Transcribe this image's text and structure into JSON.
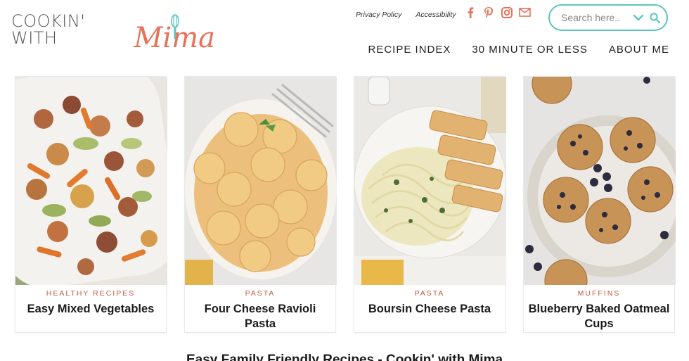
{
  "brand": {
    "logo_text": "COOKIN' WITH",
    "logo_script": "Mima",
    "accent_color": "#e8715a",
    "teal_color": "#5cc4c2"
  },
  "utility_nav": {
    "privacy": "Privacy Policy",
    "accessibility": "Accessibility"
  },
  "social_icons": [
    "facebook-icon",
    "pinterest-icon",
    "instagram-icon",
    "email-icon"
  ],
  "search": {
    "placeholder": "Search here.."
  },
  "main_nav": [
    {
      "label": "RECIPE INDEX"
    },
    {
      "label": "30 MINUTE OR LESS"
    },
    {
      "label": "ABOUT ME"
    }
  ],
  "cards": [
    {
      "category": "HEALTHY RECIPES",
      "title": "Easy Mixed Vegetables"
    },
    {
      "category": "PASTA",
      "title": "Four Cheese Ravioli Pasta"
    },
    {
      "category": "PASTA",
      "title": "Boursin Cheese Pasta"
    },
    {
      "category": "MUFFINS",
      "title": "Blueberry Baked Oatmeal Cups"
    }
  ],
  "tagline": "Easy Family Friendly Recipes - Cookin' with Mima"
}
